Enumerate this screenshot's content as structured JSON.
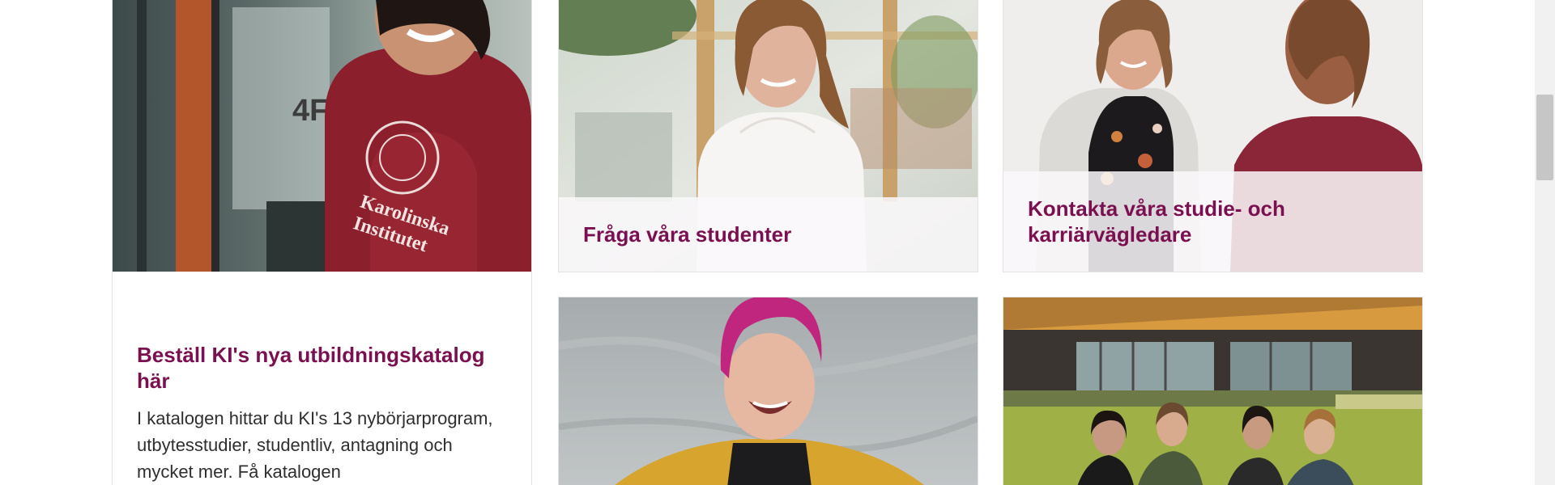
{
  "cards": {
    "catalog": {
      "title": "Beställ KI's nya utbildningskatalog här",
      "text": "I katalogen hittar du KI's 13 nybörjarprogram, utbytesstudier, studentliv, antagning och mycket mer.  Få katalogen",
      "photo_print": "Karolinska Institutet"
    },
    "ask_students": {
      "title": "Fråga våra studenter"
    },
    "contact_advisors": {
      "title": "Kontakta våra studie- och karriärvägledare"
    },
    "student_portrait": {},
    "campus_group": {}
  },
  "colors": {
    "title": "#7a1050",
    "body_text": "#2f2f2f",
    "card_border": "#e3e3e3",
    "scrollbar_thumb": "#c6c6c6"
  }
}
